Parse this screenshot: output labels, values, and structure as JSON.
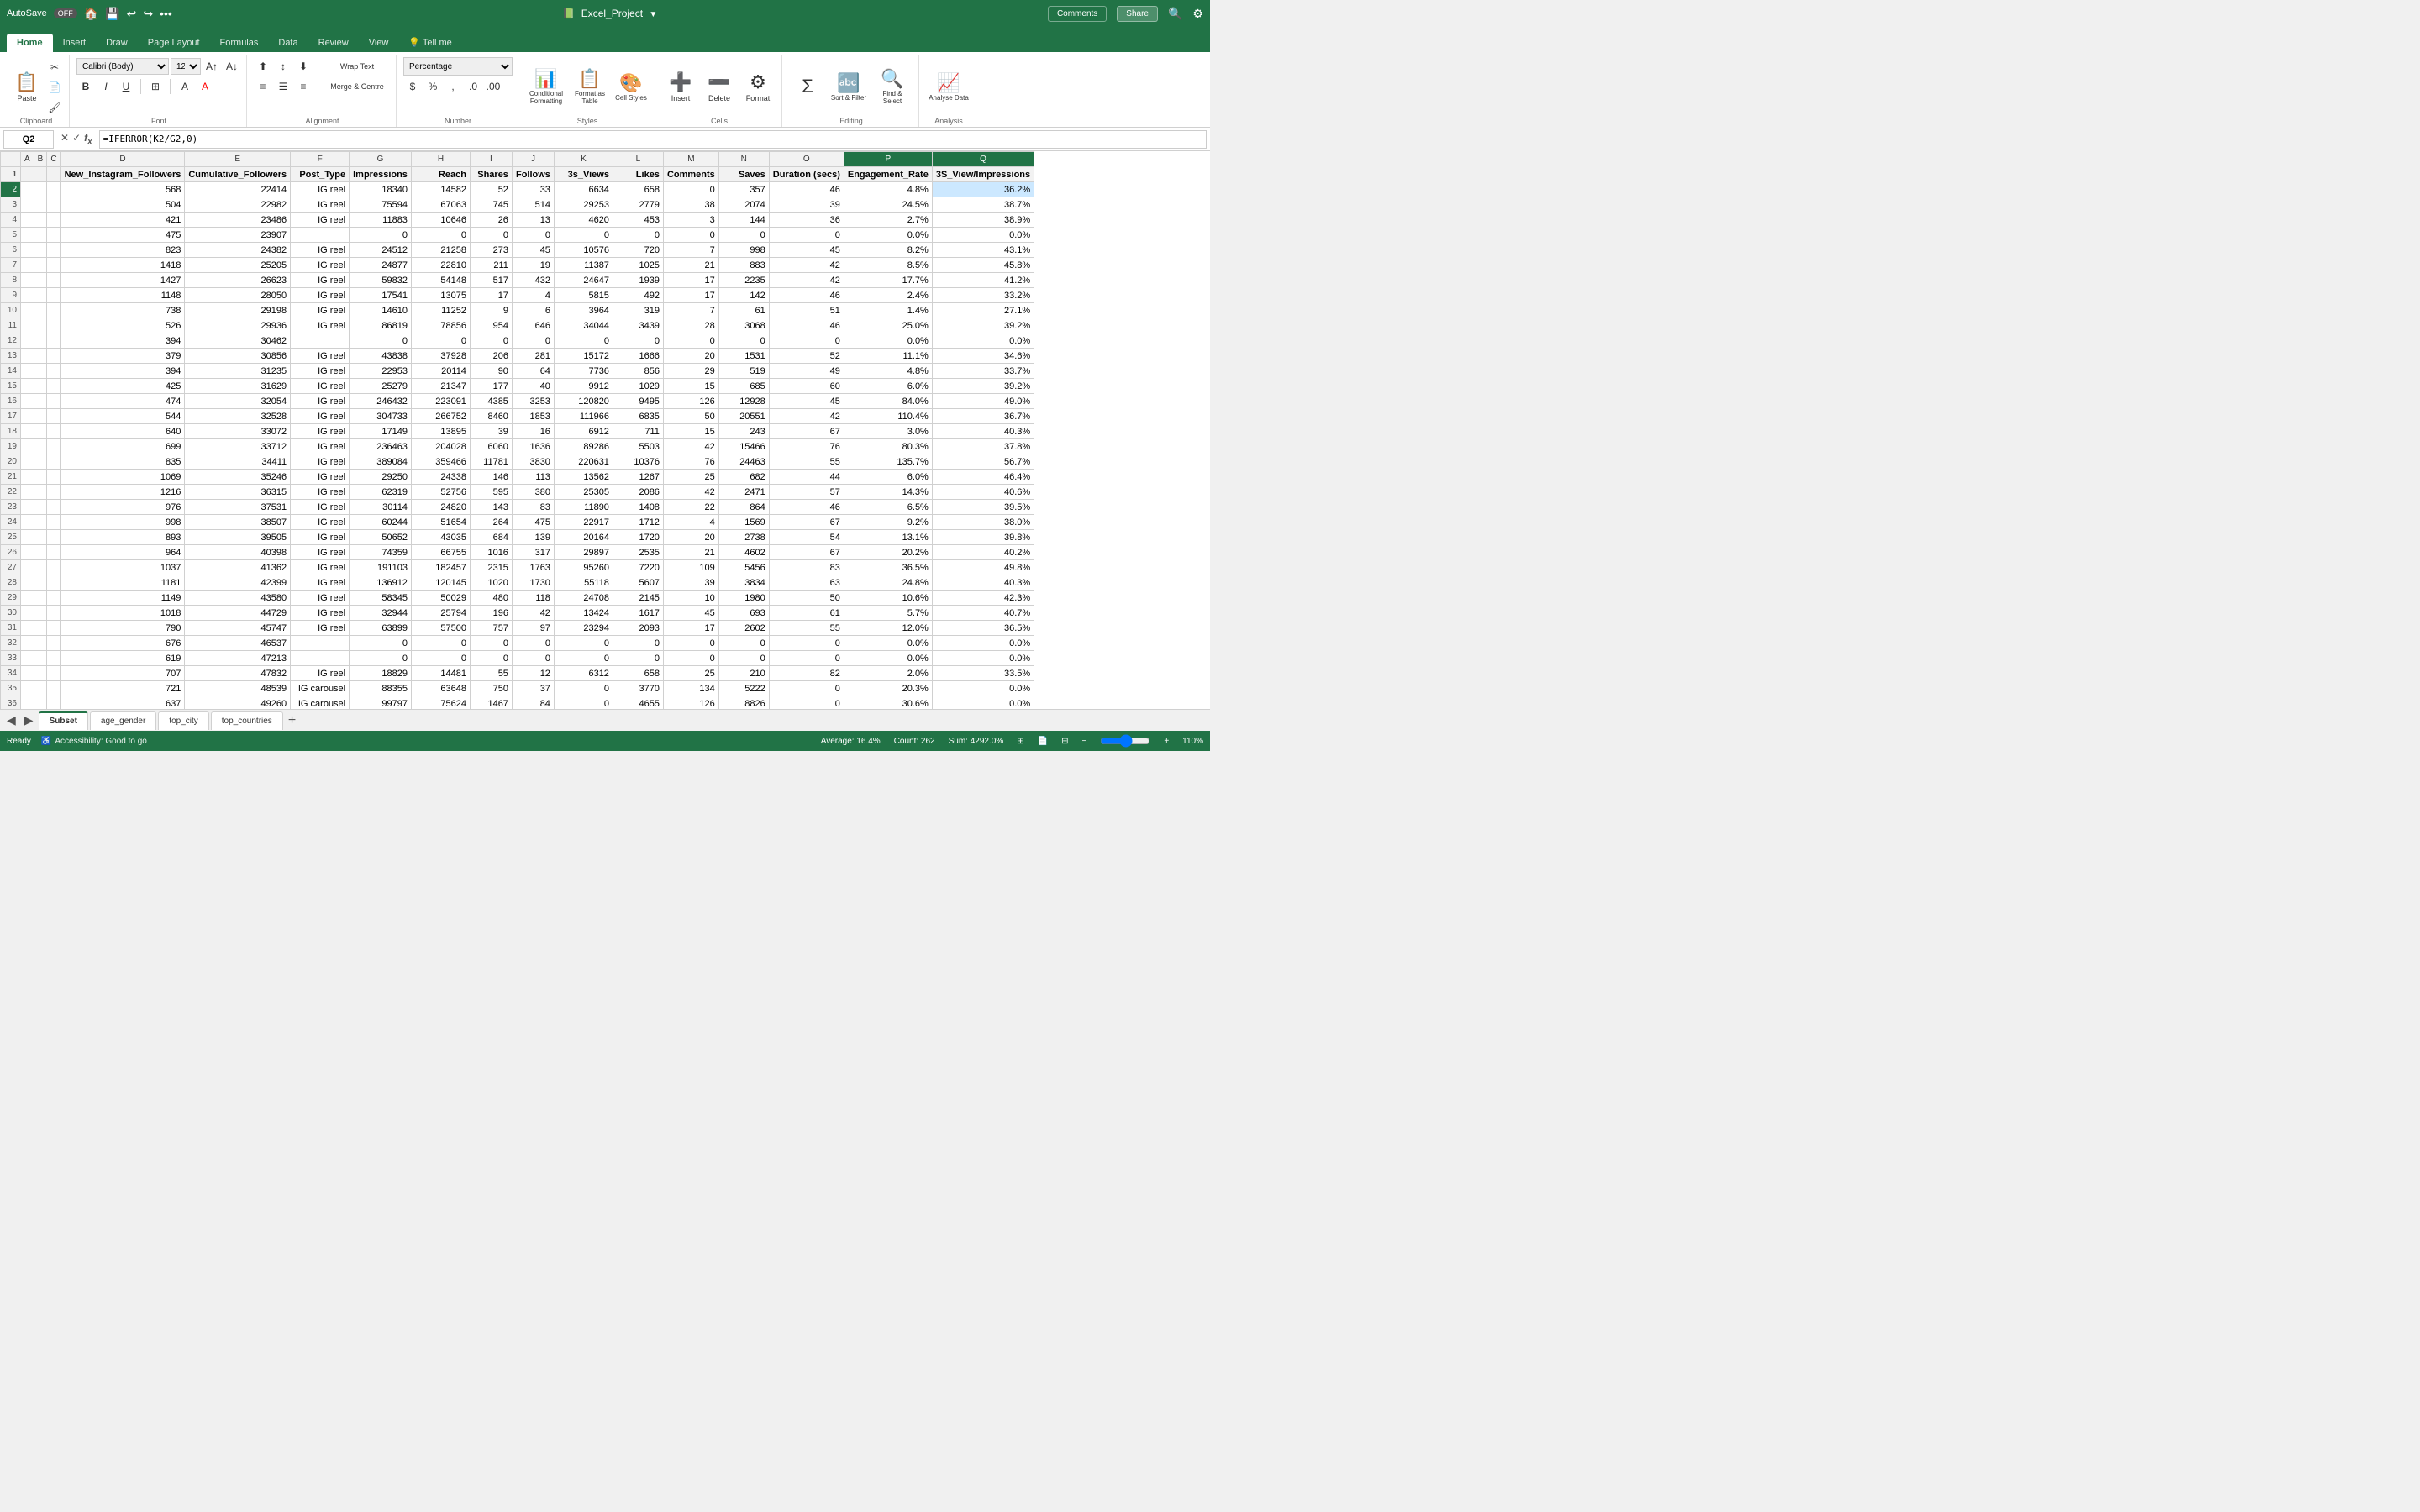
{
  "titlebar": {
    "autosave": "AutoSave",
    "autosave_state": "OFF",
    "filename": "Excel_Project",
    "search_icon": "🔍",
    "settings_icon": "⚙"
  },
  "tabs": [
    "Home",
    "Insert",
    "Draw",
    "Page Layout",
    "Formulas",
    "Data",
    "Review",
    "View",
    "Tell me"
  ],
  "active_tab": "Home",
  "ribbon": {
    "clipboard_label": "Clipboard",
    "font_label": "Font",
    "alignment_label": "Alignment",
    "number_label": "Number",
    "styles_label": "Styles",
    "cells_label": "Cells",
    "editing_label": "Editing",
    "analysis_label": "Analysis",
    "font_name": "Calibri (Body)",
    "font_size": "12",
    "wrap_text": "Wrap Text",
    "merge_centre": "Merge & Centre",
    "number_format": "Percentage",
    "conditional_formatting": "Conditional Formatting",
    "format_as_table": "Format as Table",
    "cell_styles": "Cell Styles",
    "insert_btn": "Insert",
    "delete_btn": "Delete",
    "format_btn": "Format",
    "sort_filter": "Sort & Filter",
    "find_select": "Find & Select",
    "analyse_data": "Analyse Data",
    "comments_btn": "Comments",
    "share_btn": "Share"
  },
  "formula_bar": {
    "cell_ref": "Q2",
    "formula": "=IFERROR(K2/G2,0)"
  },
  "columns": {
    "row_header": "",
    "A": "A",
    "B": "B",
    "C": "C",
    "D": "D",
    "E": "E",
    "F": "F",
    "G": "G",
    "H": "H",
    "I": "I",
    "J": "J",
    "K": "K",
    "L": "L",
    "M": "M",
    "N": "N",
    "O": "O",
    "P": "P",
    "Q": "Q"
  },
  "header_row": {
    "cols": [
      "",
      "",
      "",
      "New_Instagram_Followers",
      "Cumulative_Followers",
      "Post_Type",
      "Impressions",
      "Reach",
      "Shares",
      "Follows",
      "3s_Views",
      "Likes",
      "Comments",
      "Saves",
      "Duration (secs)",
      "Engagement_Rate",
      "3S_View/Impressions"
    ]
  },
  "data_rows": [
    {
      "row": 2,
      "d": "568",
      "e": "22414",
      "f": "IG reel",
      "g": "18340",
      "h": "14582",
      "i": "52",
      "j": "33",
      "k": "6634",
      "l": "658",
      "m": "0",
      "n": "357",
      "o": "46",
      "p": "4.8%",
      "q": "36.2%"
    },
    {
      "row": 3,
      "d": "504",
      "e": "22982",
      "f": "IG reel",
      "g": "75594",
      "h": "67063",
      "i": "745",
      "j": "514",
      "k": "29253",
      "l": "2779",
      "m": "38",
      "n": "2074",
      "o": "39",
      "p": "24.5%",
      "q": "38.7%"
    },
    {
      "row": 4,
      "d": "421",
      "e": "23486",
      "f": "IG reel",
      "g": "11883",
      "h": "10646",
      "i": "26",
      "j": "13",
      "k": "4620",
      "l": "453",
      "m": "3",
      "n": "144",
      "o": "36",
      "p": "2.7%",
      "q": "38.9%"
    },
    {
      "row": 5,
      "d": "475",
      "e": "23907",
      "f": "",
      "g": "0",
      "h": "0",
      "i": "0",
      "j": "0",
      "k": "0",
      "l": "0",
      "m": "0",
      "n": "0",
      "o": "0",
      "p": "0.0%",
      "q": "0.0%"
    },
    {
      "row": 6,
      "d": "823",
      "e": "24382",
      "f": "IG reel",
      "g": "24512",
      "h": "21258",
      "i": "273",
      "j": "45",
      "k": "10576",
      "l": "720",
      "m": "7",
      "n": "998",
      "o": "45",
      "p": "8.2%",
      "q": "43.1%"
    },
    {
      "row": 7,
      "d": "1418",
      "e": "25205",
      "f": "IG reel",
      "g": "24877",
      "h": "22810",
      "i": "211",
      "j": "19",
      "k": "11387",
      "l": "1025",
      "m": "21",
      "n": "883",
      "o": "42",
      "p": "8.5%",
      "q": "45.8%"
    },
    {
      "row": 8,
      "d": "1427",
      "e": "26623",
      "f": "IG reel",
      "g": "59832",
      "h": "54148",
      "i": "517",
      "j": "432",
      "k": "24647",
      "l": "1939",
      "m": "17",
      "n": "2235",
      "o": "42",
      "p": "17.7%",
      "q": "41.2%"
    },
    {
      "row": 9,
      "d": "1148",
      "e": "28050",
      "f": "IG reel",
      "g": "17541",
      "h": "13075",
      "i": "17",
      "j": "4",
      "k": "5815",
      "l": "492",
      "m": "17",
      "n": "142",
      "o": "46",
      "p": "2.4%",
      "q": "33.2%"
    },
    {
      "row": 10,
      "d": "738",
      "e": "29198",
      "f": "IG reel",
      "g": "14610",
      "h": "11252",
      "i": "9",
      "j": "6",
      "k": "3964",
      "l": "319",
      "m": "7",
      "n": "61",
      "o": "51",
      "p": "1.4%",
      "q": "27.1%"
    },
    {
      "row": 11,
      "d": "526",
      "e": "29936",
      "f": "IG reel",
      "g": "86819",
      "h": "78856",
      "i": "954",
      "j": "646",
      "k": "34044",
      "l": "3439",
      "m": "28",
      "n": "3068",
      "o": "46",
      "p": "25.0%",
      "q": "39.2%"
    },
    {
      "row": 12,
      "d": "394",
      "e": "30462",
      "f": "",
      "g": "0",
      "h": "0",
      "i": "0",
      "j": "0",
      "k": "0",
      "l": "0",
      "m": "0",
      "n": "0",
      "o": "0",
      "p": "0.0%",
      "q": "0.0%"
    },
    {
      "row": 13,
      "d": "379",
      "e": "30856",
      "f": "IG reel",
      "g": "43838",
      "h": "37928",
      "i": "206",
      "j": "281",
      "k": "15172",
      "l": "1666",
      "m": "20",
      "n": "1531",
      "o": "52",
      "p": "11.1%",
      "q": "34.6%"
    },
    {
      "row": 14,
      "d": "394",
      "e": "31235",
      "f": "IG reel",
      "g": "22953",
      "h": "20114",
      "i": "90",
      "j": "64",
      "k": "7736",
      "l": "856",
      "m": "29",
      "n": "519",
      "o": "49",
      "p": "4.8%",
      "q": "33.7%"
    },
    {
      "row": 15,
      "d": "425",
      "e": "31629",
      "f": "IG reel",
      "g": "25279",
      "h": "21347",
      "i": "177",
      "j": "40",
      "k": "9912",
      "l": "1029",
      "m": "15",
      "n": "685",
      "o": "60",
      "p": "6.0%",
      "q": "39.2%"
    },
    {
      "row": 16,
      "d": "474",
      "e": "32054",
      "f": "IG reel",
      "g": "246432",
      "h": "223091",
      "i": "4385",
      "j": "3253",
      "k": "120820",
      "l": "9495",
      "m": "126",
      "n": "12928",
      "o": "45",
      "p": "84.0%",
      "q": "49.0%"
    },
    {
      "row": 17,
      "d": "544",
      "e": "32528",
      "f": "IG reel",
      "g": "304733",
      "h": "266752",
      "i": "8460",
      "j": "1853",
      "k": "111966",
      "l": "6835",
      "m": "50",
      "n": "20551",
      "o": "42",
      "p": "110.4%",
      "q": "36.7%"
    },
    {
      "row": 18,
      "d": "640",
      "e": "33072",
      "f": "IG reel",
      "g": "17149",
      "h": "13895",
      "i": "39",
      "j": "16",
      "k": "6912",
      "l": "711",
      "m": "15",
      "n": "243",
      "o": "67",
      "p": "3.0%",
      "q": "40.3%"
    },
    {
      "row": 19,
      "d": "699",
      "e": "33712",
      "f": "IG reel",
      "g": "236463",
      "h": "204028",
      "i": "6060",
      "j": "1636",
      "k": "89286",
      "l": "5503",
      "m": "42",
      "n": "15466",
      "o": "76",
      "p": "80.3%",
      "q": "37.8%"
    },
    {
      "row": 20,
      "d": "835",
      "e": "34411",
      "f": "IG reel",
      "g": "389084",
      "h": "359466",
      "i": "11781",
      "j": "3830",
      "k": "220631",
      "l": "10376",
      "m": "76",
      "n": "24463",
      "o": "55",
      "p": "135.7%",
      "q": "56.7%"
    },
    {
      "row": 21,
      "d": "1069",
      "e": "35246",
      "f": "IG reel",
      "g": "29250",
      "h": "24338",
      "i": "146",
      "j": "113",
      "k": "13562",
      "l": "1267",
      "m": "25",
      "n": "682",
      "o": "44",
      "p": "6.0%",
      "q": "46.4%"
    },
    {
      "row": 22,
      "d": "1216",
      "e": "36315",
      "f": "IG reel",
      "g": "62319",
      "h": "52756",
      "i": "595",
      "j": "380",
      "k": "25305",
      "l": "2086",
      "m": "42",
      "n": "2471",
      "o": "57",
      "p": "14.3%",
      "q": "40.6%"
    },
    {
      "row": 23,
      "d": "976",
      "e": "37531",
      "f": "IG reel",
      "g": "30114",
      "h": "24820",
      "i": "143",
      "j": "83",
      "k": "11890",
      "l": "1408",
      "m": "22",
      "n": "864",
      "o": "46",
      "p": "6.5%",
      "q": "39.5%"
    },
    {
      "row": 24,
      "d": "998",
      "e": "38507",
      "f": "IG reel",
      "g": "60244",
      "h": "51654",
      "i": "264",
      "j": "475",
      "k": "22917",
      "l": "1712",
      "m": "4",
      "n": "1569",
      "o": "67",
      "p": "9.2%",
      "q": "38.0%"
    },
    {
      "row": 25,
      "d": "893",
      "e": "39505",
      "f": "IG reel",
      "g": "50652",
      "h": "43035",
      "i": "684",
      "j": "139",
      "k": "20164",
      "l": "1720",
      "m": "20",
      "n": "2738",
      "o": "54",
      "p": "13.1%",
      "q": "39.8%"
    },
    {
      "row": 26,
      "d": "964",
      "e": "40398",
      "f": "IG reel",
      "g": "74359",
      "h": "66755",
      "i": "1016",
      "j": "317",
      "k": "29897",
      "l": "2535",
      "m": "21",
      "n": "4602",
      "o": "67",
      "p": "20.2%",
      "q": "40.2%"
    },
    {
      "row": 27,
      "d": "1037",
      "e": "41362",
      "f": "IG reel",
      "g": "191103",
      "h": "182457",
      "i": "2315",
      "j": "1763",
      "k": "95260",
      "l": "7220",
      "m": "109",
      "n": "5456",
      "o": "83",
      "p": "36.5%",
      "q": "49.8%"
    },
    {
      "row": 28,
      "d": "1181",
      "e": "42399",
      "f": "IG reel",
      "g": "136912",
      "h": "120145",
      "i": "1020",
      "j": "1730",
      "k": "55118",
      "l": "5607",
      "m": "39",
      "n": "3834",
      "o": "63",
      "p": "24.8%",
      "q": "40.3%"
    },
    {
      "row": 29,
      "d": "1149",
      "e": "43580",
      "f": "IG reel",
      "g": "58345",
      "h": "50029",
      "i": "480",
      "j": "118",
      "k": "24708",
      "l": "2145",
      "m": "10",
      "n": "1980",
      "o": "50",
      "p": "10.6%",
      "q": "42.3%"
    },
    {
      "row": 30,
      "d": "1018",
      "e": "44729",
      "f": "IG reel",
      "g": "32944",
      "h": "25794",
      "i": "196",
      "j": "42",
      "k": "13424",
      "l": "1617",
      "m": "45",
      "n": "693",
      "o": "61",
      "p": "5.7%",
      "q": "40.7%"
    },
    {
      "row": 31,
      "d": "790",
      "e": "45747",
      "f": "IG reel",
      "g": "63899",
      "h": "57500",
      "i": "757",
      "j": "97",
      "k": "23294",
      "l": "2093",
      "m": "17",
      "n": "2602",
      "o": "55",
      "p": "12.0%",
      "q": "36.5%"
    },
    {
      "row": 32,
      "d": "676",
      "e": "46537",
      "f": "",
      "g": "0",
      "h": "0",
      "i": "0",
      "j": "0",
      "k": "0",
      "l": "0",
      "m": "0",
      "n": "0",
      "o": "0",
      "p": "0.0%",
      "q": "0.0%"
    },
    {
      "row": 33,
      "d": "619",
      "e": "47213",
      "f": "",
      "g": "0",
      "h": "0",
      "i": "0",
      "j": "0",
      "k": "0",
      "l": "0",
      "m": "0",
      "n": "0",
      "o": "0",
      "p": "0.0%",
      "q": "0.0%"
    },
    {
      "row": 34,
      "d": "707",
      "e": "47832",
      "f": "IG reel",
      "g": "18829",
      "h": "14481",
      "i": "55",
      "j": "12",
      "k": "6312",
      "l": "658",
      "m": "25",
      "n": "210",
      "o": "82",
      "p": "2.0%",
      "q": "33.5%"
    },
    {
      "row": 35,
      "d": "721",
      "e": "48539",
      "f": "IG carousel",
      "g": "88355",
      "h": "63648",
      "i": "750",
      "j": "37",
      "k": "0",
      "l": "3770",
      "m": "134",
      "n": "5222",
      "o": "0",
      "p": "20.3%",
      "q": "0.0%"
    },
    {
      "row": 36,
      "d": "637",
      "e": "49260",
      "f": "IG carousel",
      "g": "99797",
      "h": "75624",
      "i": "1467",
      "j": "84",
      "k": "0",
      "l": "4655",
      "m": "126",
      "n": "8826",
      "o": "0",
      "p": "30.6%",
      "q": "0.0%"
    }
  ],
  "sheet_tabs": [
    "Subset",
    "age_gender",
    "top_city",
    "top_countries"
  ],
  "active_sheet": "Subset",
  "status_bar": {
    "ready": "Ready",
    "accessibility": "Accessibility: Good to go",
    "average": "Average: 16.4%",
    "count": "Count: 262",
    "sum": "Sum: 4292.0%",
    "zoom": "110%"
  }
}
